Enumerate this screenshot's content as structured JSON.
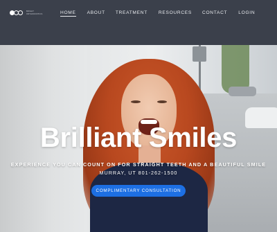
{
  "logo": {
    "text_line1": "BRIGHT",
    "text_line2": "ORTHODONTICS"
  },
  "nav": {
    "items": [
      {
        "label": "HOME",
        "active": true
      },
      {
        "label": "ABOUT"
      },
      {
        "label": "TREATMENT"
      },
      {
        "label": "RESOURCES"
      },
      {
        "label": "CONTACT"
      },
      {
        "label": "LOGIN"
      }
    ]
  },
  "hero": {
    "headline": "Brilliant Smiles",
    "tagline": "EXPERIENCE YOU CAN COUNT ON FOR STRAIGHT TEETH AND A BEAUTIFUL SMILE",
    "location": "MURRAY, UT 801-262-1500",
    "cta_label": "COMPLIMENTARY CONSULTATION"
  },
  "colors": {
    "header_bg": "#3b404b",
    "accent": "#1d6fe3",
    "text_light": "#ffffff"
  }
}
